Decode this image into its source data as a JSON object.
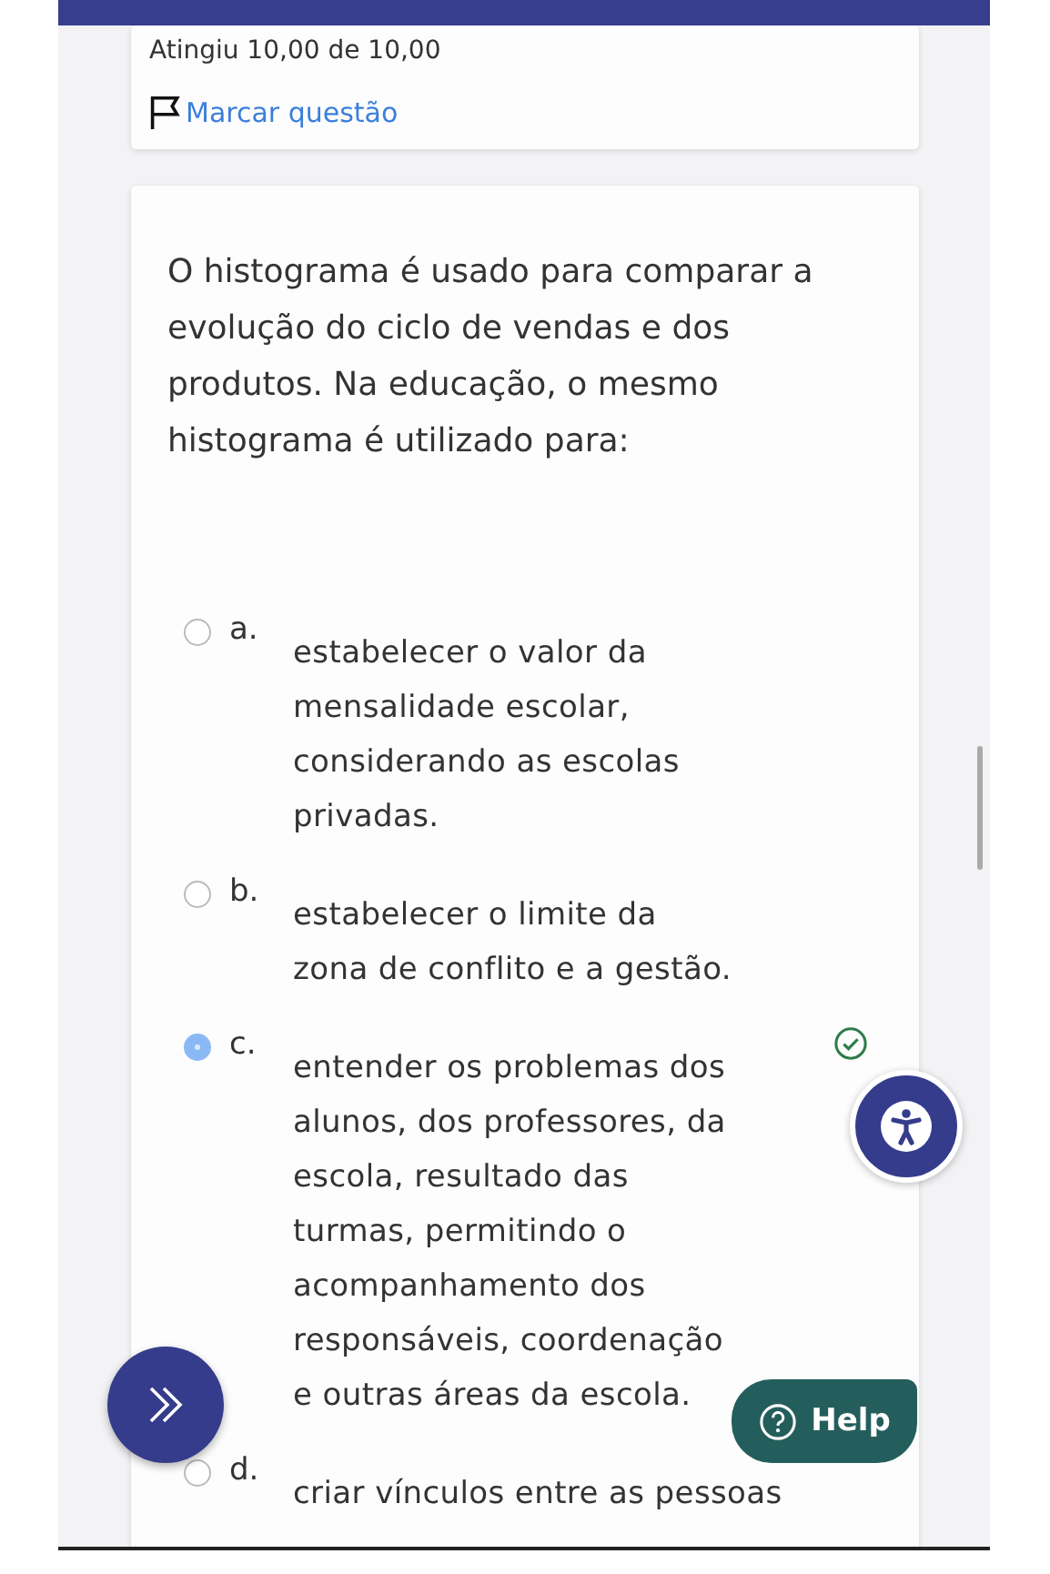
{
  "feedback": {
    "grade": "Atingiu 10,00 de 10,00",
    "flag_link": "Marcar questão"
  },
  "question": {
    "text": "O histograma é usado para comparar a evolução do ciclo de vendas e dos produtos. Na educação, o mesmo histograma é utilizado para:",
    "options": [
      {
        "letter": "a.",
        "text": "estabelecer o valor da mensalidade escolar, considerando as escolas privadas.",
        "selected": false,
        "correct": false
      },
      {
        "letter": "b.",
        "text": "estabelecer o limite da zona de conflito e a gestão.",
        "selected": false,
        "correct": false
      },
      {
        "letter": "c.",
        "text": "entender os problemas dos alunos, dos professores, da escola, resultado das turmas, permitindo o acompanhamento dos responsáveis, coordenação e outras áreas da escola.",
        "selected": true,
        "correct": true
      },
      {
        "letter": "d.",
        "text": "criar vínculos entre as pessoas",
        "selected": false,
        "correct": false
      }
    ]
  },
  "help_button": {
    "label": "Help"
  }
}
